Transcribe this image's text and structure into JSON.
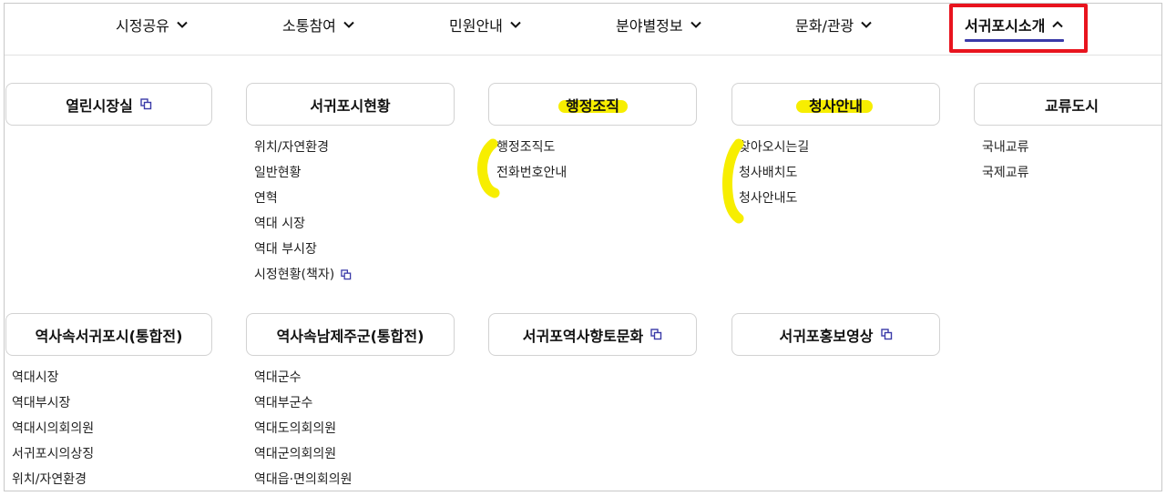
{
  "nav": {
    "items": [
      {
        "label": "시정공유"
      },
      {
        "label": "소통참여"
      },
      {
        "label": "민원안내"
      },
      {
        "label": "분야별정보"
      },
      {
        "label": "문화/관광"
      },
      {
        "label": "서귀포시소개",
        "active": true
      }
    ],
    "accent_color": "#3a3aa8",
    "highlight_color": "#e8141e"
  },
  "sections": [
    {
      "title": "열린시장실",
      "external": true,
      "links": []
    },
    {
      "title": "서귀포시현황",
      "links": [
        {
          "label": "위치/자연환경"
        },
        {
          "label": "일반현황"
        },
        {
          "label": "연혁"
        },
        {
          "label": "역대 시장"
        },
        {
          "label": "역대 부시장"
        },
        {
          "label": "시정현황(책자)",
          "external": true
        }
      ]
    },
    {
      "title": "행정조직",
      "highlighted": true,
      "links": [
        {
          "label": "행정조직도"
        },
        {
          "label": "전화번호안내"
        }
      ]
    },
    {
      "title": "청사안내",
      "highlighted": true,
      "links": [
        {
          "label": "찾아오시는길"
        },
        {
          "label": "청사배치도"
        },
        {
          "label": "청사안내도"
        }
      ]
    },
    {
      "title": "교류도시",
      "links": [
        {
          "label": "국내교류"
        },
        {
          "label": "국제교류"
        }
      ]
    },
    {
      "title": "역사속서귀포시(통합전)",
      "links": [
        {
          "label": "역대시장"
        },
        {
          "label": "역대부시장"
        },
        {
          "label": "역대시의회의원"
        },
        {
          "label": "서귀포시의상징"
        },
        {
          "label": "위치/자연환경"
        }
      ]
    },
    {
      "title": "역사속남제주군(통합전)",
      "links": [
        {
          "label": "역대군수"
        },
        {
          "label": "역대부군수"
        },
        {
          "label": "역대도의회의원"
        },
        {
          "label": "역대군의회의원"
        },
        {
          "label": "역대읍·면의회의원"
        }
      ]
    },
    {
      "title": "서귀포역사향토문화",
      "external": true,
      "links": []
    },
    {
      "title": "서귀포홍보영상",
      "external": true,
      "links": []
    }
  ],
  "highlighter_color": "#f7ee00",
  "icons": {
    "chevron": "chevron-down-icon",
    "chevron_active": "chevron-up-icon",
    "external": "external-link-icon"
  }
}
